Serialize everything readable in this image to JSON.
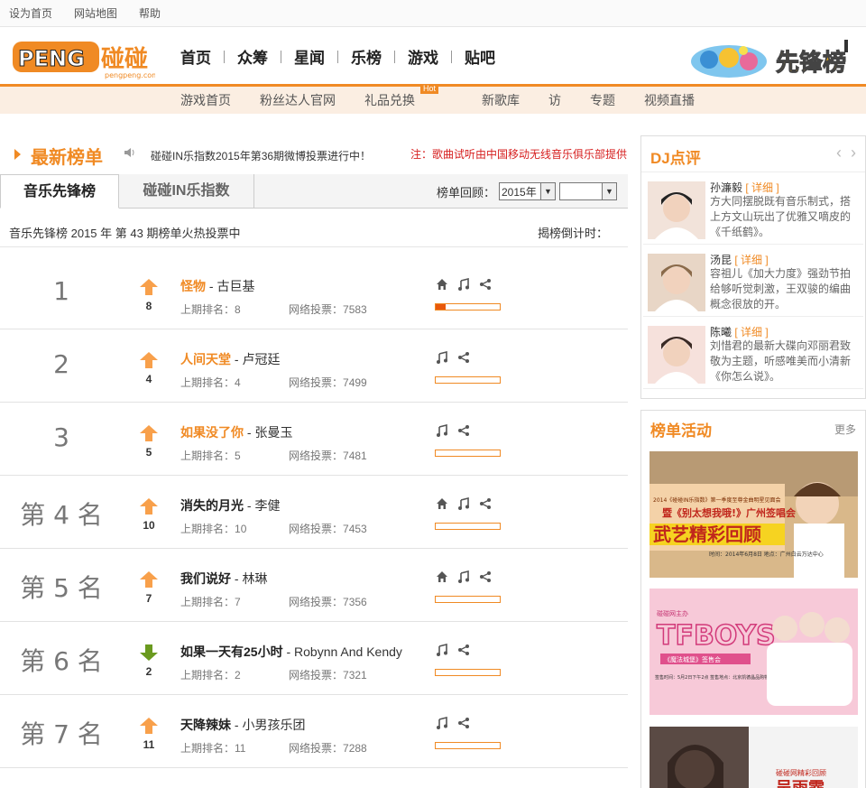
{
  "topbar": {
    "sethome": "设为首页",
    "sitemap": "网站地图",
    "help": "帮助"
  },
  "logo": {
    "brand": "PENG",
    "cn": "碰碰",
    "site": "pengpeng.com"
  },
  "mainnav": [
    "首页",
    "众筹",
    "星闻",
    "乐榜",
    "游戏",
    "贴吧"
  ],
  "subnav": {
    "items": [
      "游戏首页",
      "粉丝达人官网",
      "礼品兑换",
      "新歌库",
      "访",
      "专题",
      "视频直播"
    ],
    "hot": "Hot"
  },
  "section": {
    "title": "最新榜单",
    "marquee": "碰碰IN乐指数2015年第36期微博投票进行中！",
    "notice": "注：歌曲试听由中国移动无线音乐俱乐部提供"
  },
  "tabs": {
    "active": "音乐先锋榜",
    "other": "碰碰IN乐指数"
  },
  "review": {
    "label": "榜单回顾：",
    "year": "2015年",
    "period": ""
  },
  "period": {
    "text": "音乐先锋榜 2015  年 第 43 期榜单火热投票中",
    "countdown": "揭榜倒计时："
  },
  "labels": {
    "prev": "上期排名：",
    "votes": "网络投票："
  },
  "rows": [
    {
      "rank": "1",
      "trend": "up",
      "change": "8",
      "name": "怪物",
      "artist": " - 古巨基",
      "prev": "8",
      "votes": "7583",
      "highlight": true,
      "home": true,
      "progress": 0.15
    },
    {
      "rank": "2",
      "trend": "up",
      "change": "4",
      "name": "人间天堂",
      "artist": " - 卢冠廷",
      "prev": "4",
      "votes": "7499",
      "highlight": true,
      "home": false,
      "progress": 0
    },
    {
      "rank": "3",
      "trend": "up",
      "change": "5",
      "name": "如果没了你",
      "artist": " - 张曼玉",
      "prev": "5",
      "votes": "7481",
      "highlight": true,
      "home": false,
      "progress": 0
    },
    {
      "rank": "第 4 名",
      "trend": "up",
      "change": "10",
      "name": "消失的月光",
      "artist": " - 李健",
      "prev": "10",
      "votes": "7453",
      "highlight": false,
      "home": true,
      "progress": 0
    },
    {
      "rank": "第 5 名",
      "trend": "up",
      "change": "7",
      "name": "我们说好",
      "artist": " - 林琳",
      "prev": "7",
      "votes": "7356",
      "highlight": false,
      "home": true,
      "progress": 0
    },
    {
      "rank": "第 6 名",
      "trend": "down",
      "change": "2",
      "name": "如果一天有25小时",
      "artist": " - Robynn And Kendy",
      "prev": "2",
      "votes": "7321",
      "highlight": false,
      "home": false,
      "progress": 0
    },
    {
      "rank": "第 7 名",
      "trend": "up",
      "change": "11",
      "name": "天降辣妹",
      "artist": " - 小男孩乐团",
      "prev": "11",
      "votes": "7288",
      "highlight": false,
      "home": false,
      "progress": 0
    }
  ],
  "dj": {
    "title": "DJ点评",
    "detail": "[ 详细 ]",
    "items": [
      {
        "name": "孙濂毅",
        "text": "方大同摆脱既有音乐制式，搭上方文山玩出了优雅又嘀皮的《千纸鹤》。"
      },
      {
        "name": "汤昆",
        "text": "容祖儿《加大力度》强劲节拍给够听觉刺激，王双骏的编曲概念很放的开。"
      },
      {
        "name": "陈曦",
        "text": "刘惜君的最新大碟向邓丽君致敬为主题，听感唯美而小清新《你怎么说》。"
      }
    ]
  },
  "activity": {
    "title": "榜单活动",
    "more": "更多",
    "banners": [
      {
        "line1": "2014《碰碰IN乐指数》第一季度至尊金曲明星见面会",
        "line2": "暨《别太想我哦!》广州签唱会",
        "headline": "武艺精彩回顾",
        "info": "时间：2014年6月8日 地点：广州白云万达中心"
      },
      {
        "line1": "碰碰网主办",
        "headline": "TFBOYS",
        "line2": "《魔法城堡》签售会",
        "info": "签售时间：5月2日下午2点 签售地点：北京凯德晶品购物中心"
      },
      {
        "line1": "碰碰网精彩回顾",
        "headline": "吴雨霏"
      }
    ]
  },
  "colors": {
    "accent": "#f08a24",
    "notice": "#d61e1e",
    "down": "#6a9a1f"
  }
}
